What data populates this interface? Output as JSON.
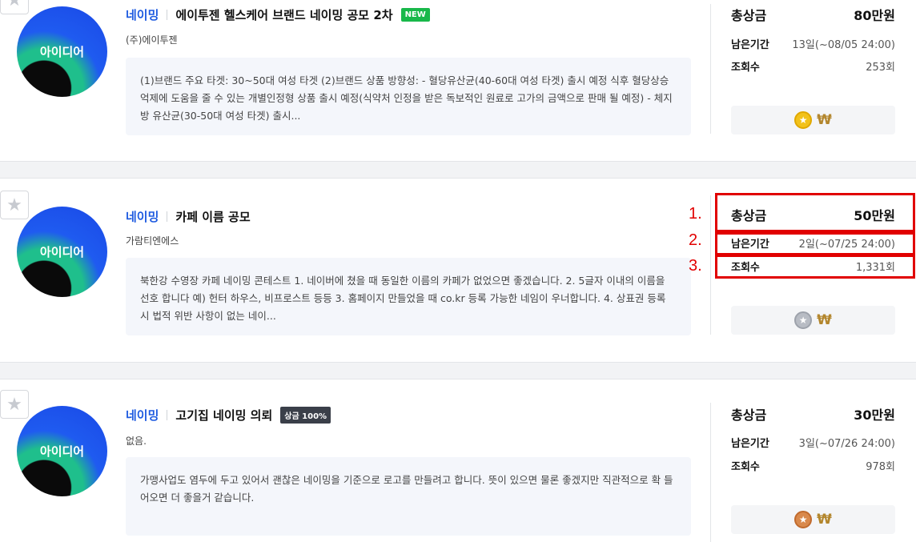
{
  "listings": [
    {
      "category": "네이밍",
      "title": "에이투젠 헬스케어 브랜드 네이밍 공모 2차",
      "badge": "NEW",
      "company": "(주)에이투젠",
      "thumb_text": "아이디어",
      "description": "(1)브랜드 주요 타겟: 30~50대 여성 타겟 (2)브랜드 상품 방향성: - 혈당유산균(40-60대 여성 타겟) 출시 예정 식후 혈당상승 억제에 도움을 줄 수 있는 개별인정형 상품 출시 예정(식약처 인정을 받은 독보적인 원료로 고가의 금액으로 판매 될 예정) - 체지방 유산균(30-50대 여성 타겟) 출시...",
      "prize_label": "총상금",
      "prize": "80만원",
      "period_label": "남은기간",
      "period": "13일(~08/05 24:00)",
      "views_label": "조회수",
      "views": "253회",
      "coin": "gold",
      "won_symbol": "₩"
    },
    {
      "category": "네이밍",
      "title": "카페 이름 공모",
      "badge": "",
      "company": "가람티엔에스",
      "thumb_text": "아이디어",
      "description": "북한강 수영장 카페 네이밍 콘테스트 1. 네이버에 쳤을 때 동일한 이름의 카페가 없었으면 좋겠습니다. 2. 5글자 이내의 이름을 선호 합니다 예) 헌터 하우스, 비프로스트 등등 3. 홈페이지 만들었을 때 co.kr 등록 가능한 네임이 우너합니다. 4. 상표권 등록 시 법적 위반 사항이 없는 네이...",
      "prize_label": "총상금",
      "prize": "50만원",
      "period_label": "남은기간",
      "period": "2일(~07/25 24:00)",
      "views_label": "조회수",
      "views": "1,331회",
      "coin": "silver",
      "won_symbol": "₩"
    },
    {
      "category": "네이밍",
      "title": "고기집 네이밍 의뢰",
      "badge": "상금 100%",
      "company": "없음.",
      "thumb_text": "아이디어",
      "description": "가맹사업도 염두에 두고 있어서 괜찮은 네이밍을 기준으로 로고를 만들려고 합니다. 뜻이 있으면 물론 좋겠지만 직관적으로 확 들어오면 더 좋을거 같습니다.",
      "prize_label": "총상금",
      "prize": "30만원",
      "period_label": "남은기간",
      "period": "3일(~07/26 24:00)",
      "views_label": "조회수",
      "views": "978회",
      "coin": "bronze",
      "won_symbol": "₩"
    }
  ],
  "annotations": {
    "n1": "1.",
    "n2": "2.",
    "n3": "3.",
    "color": "#e10000"
  },
  "star_glyph": "★",
  "coin_glyph": "★"
}
